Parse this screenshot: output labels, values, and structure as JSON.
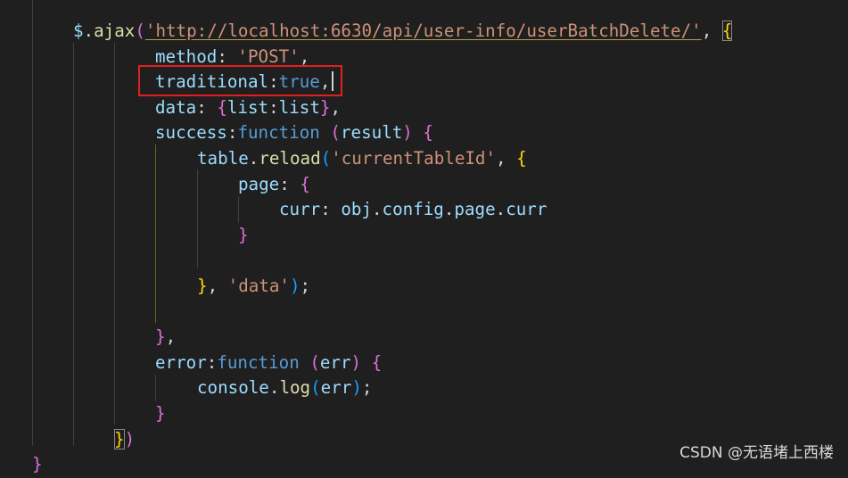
{
  "code": {
    "lines": [
      {
        "indent": 82,
        "tokens": [
          {
            "t": "$",
            "c": "var"
          },
          {
            "t": ".",
            "c": "punc"
          },
          {
            "t": "ajax",
            "c": "fn"
          },
          {
            "t": "(",
            "c": "b2"
          },
          {
            "t": "'http://localhost:6630/api/user-info/userBatchDelete/'",
            "c": "str",
            "u": true
          },
          {
            "t": ", ",
            "c": "punc"
          },
          {
            "t": "{",
            "c": "b1box"
          }
        ]
      },
      {
        "indent": 174,
        "tokens": [
          {
            "t": "method",
            "c": "var"
          },
          {
            "t": ": ",
            "c": "punc"
          },
          {
            "t": "'POST'",
            "c": "str"
          },
          {
            "t": ",",
            "c": "punc"
          }
        ]
      },
      {
        "indent": 174,
        "tokens": [
          {
            "t": "traditional",
            "c": "var"
          },
          {
            "t": ":",
            "c": "punc"
          },
          {
            "t": "true",
            "c": "kw"
          },
          {
            "t": ",",
            "c": "punc"
          }
        ]
      },
      {
        "indent": 174,
        "tokens": [
          {
            "t": "data",
            "c": "var"
          },
          {
            "t": ": ",
            "c": "punc"
          },
          {
            "t": "{",
            "c": "b2"
          },
          {
            "t": "list",
            "c": "var"
          },
          {
            "t": ":",
            "c": "punc"
          },
          {
            "t": "list",
            "c": "var"
          },
          {
            "t": "}",
            "c": "b2"
          },
          {
            "t": ",",
            "c": "punc"
          }
        ]
      },
      {
        "indent": 174,
        "tokens": [
          {
            "t": "success",
            "c": "var"
          },
          {
            "t": ":",
            "c": "punc"
          },
          {
            "t": "function",
            "c": "kw"
          },
          {
            "t": " ",
            "c": "punc"
          },
          {
            "t": "(",
            "c": "b2"
          },
          {
            "t": "result",
            "c": "var"
          },
          {
            "t": ")",
            "c": "b2"
          },
          {
            "t": " ",
            "c": "punc"
          },
          {
            "t": "{",
            "c": "b2"
          }
        ]
      },
      {
        "indent": 221,
        "tokens": [
          {
            "t": "table",
            "c": "var"
          },
          {
            "t": ".",
            "c": "punc"
          },
          {
            "t": "reload",
            "c": "fn"
          },
          {
            "t": "(",
            "c": "b3"
          },
          {
            "t": "'currentTableId'",
            "c": "str"
          },
          {
            "t": ", ",
            "c": "punc"
          },
          {
            "t": "{",
            "c": "b1"
          }
        ]
      },
      {
        "indent": 267,
        "tokens": [
          {
            "t": "page",
            "c": "var"
          },
          {
            "t": ": ",
            "c": "punc"
          },
          {
            "t": "{",
            "c": "b2"
          }
        ]
      },
      {
        "indent": 313,
        "tokens": [
          {
            "t": "curr",
            "c": "var"
          },
          {
            "t": ": ",
            "c": "punc"
          },
          {
            "t": "obj",
            "c": "var"
          },
          {
            "t": ".",
            "c": "punc"
          },
          {
            "t": "config",
            "c": "var"
          },
          {
            "t": ".",
            "c": "punc"
          },
          {
            "t": "page",
            "c": "var"
          },
          {
            "t": ".",
            "c": "punc"
          },
          {
            "t": "curr",
            "c": "var"
          }
        ]
      },
      {
        "indent": 267,
        "tokens": [
          {
            "t": "}",
            "c": "b2"
          }
        ]
      },
      {
        "indent": 221,
        "tokens": []
      },
      {
        "indent": 221,
        "tokens": [
          {
            "t": "}",
            "c": "b1"
          },
          {
            "t": ", ",
            "c": "punc"
          },
          {
            "t": "'data'",
            "c": "str"
          },
          {
            "t": ")",
            "c": "b3"
          },
          {
            "t": ";",
            "c": "punc"
          }
        ]
      },
      {
        "indent": 174,
        "tokens": []
      },
      {
        "indent": 174,
        "tokens": [
          {
            "t": "}",
            "c": "b2"
          },
          {
            "t": ",",
            "c": "punc"
          }
        ]
      },
      {
        "indent": 174,
        "tokens": [
          {
            "t": "error",
            "c": "var"
          },
          {
            "t": ":",
            "c": "punc"
          },
          {
            "t": "function",
            "c": "kw"
          },
          {
            "t": " ",
            "c": "punc"
          },
          {
            "t": "(",
            "c": "b2"
          },
          {
            "t": "err",
            "c": "var"
          },
          {
            "t": ")",
            "c": "b2"
          },
          {
            "t": " ",
            "c": "punc"
          },
          {
            "t": "{",
            "c": "b2"
          }
        ]
      },
      {
        "indent": 221,
        "tokens": [
          {
            "t": "console",
            "c": "var"
          },
          {
            "t": ".",
            "c": "punc"
          },
          {
            "t": "log",
            "c": "fn"
          },
          {
            "t": "(",
            "c": "b3"
          },
          {
            "t": "err",
            "c": "var"
          },
          {
            "t": ")",
            "c": "b3"
          },
          {
            "t": ";",
            "c": "punc"
          }
        ]
      },
      {
        "indent": 174,
        "tokens": [
          {
            "t": "}",
            "c": "b2"
          }
        ]
      },
      {
        "indent": 128,
        "tokens": [
          {
            "t": "}",
            "c": "b1box"
          },
          {
            "t": ")",
            "c": "b2"
          }
        ]
      },
      {
        "indent": 36,
        "tokens": [
          {
            "t": "}",
            "c": "b2"
          }
        ]
      }
    ]
  },
  "colors": {
    "background": "#1f1f1f",
    "highlight_box": "#e02020",
    "string": "#ce9178",
    "keyword": "#569cd6",
    "variable": "#9cdcfe",
    "function": "#dcdcaa"
  },
  "watermark": {
    "text": "CSDN @无语堵上西楼"
  }
}
